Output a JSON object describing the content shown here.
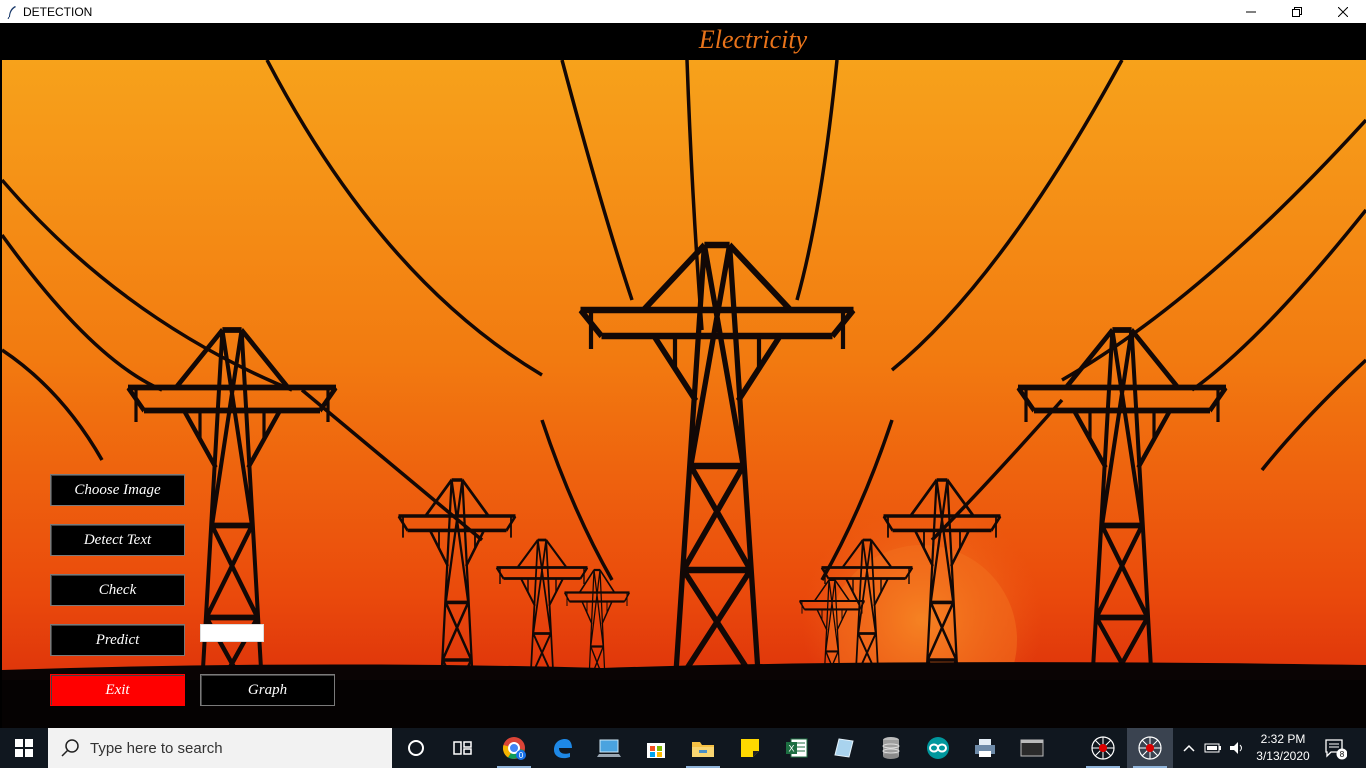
{
  "window": {
    "title": "DETECTION",
    "header_title": "Electricity"
  },
  "buttons": {
    "choose_image": "Choose Image",
    "detect_text": "Detect Text",
    "check": "Check",
    "predict": "Predict",
    "exit": "Exit",
    "graph": "Graph"
  },
  "result_value": "",
  "taskbar": {
    "search_placeholder": "Type here to search",
    "time": "2:32 PM",
    "date": "3/13/2020",
    "notification_count": "8",
    "chrome_badge": "0",
    "apps": [
      "cortana-icon",
      "task-view-icon",
      "chrome-icon",
      "edge-icon",
      "pc-icon",
      "store-icon",
      "file-explorer-icon",
      "sticky-notes-icon",
      "excel-icon",
      "notepad-icon",
      "database-icon",
      "arduino-icon",
      "printer-icon",
      "terminal-icon",
      "spider-icon",
      "spider-active-icon"
    ]
  },
  "colors": {
    "accent_title": "#e8731a",
    "exit_button": "#ff0000",
    "sky_top": "#f7a21b",
    "sky_bottom": "#e5300b"
  }
}
